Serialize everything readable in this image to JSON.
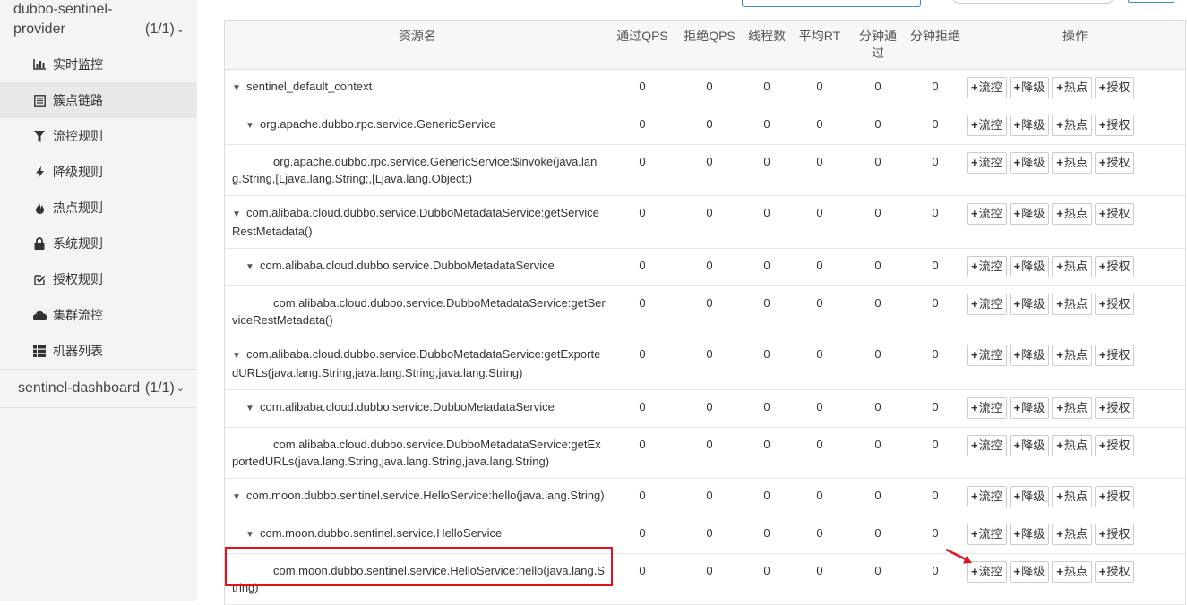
{
  "sidebar": {
    "app1": {
      "name_line1": "dubbo-sentinel-",
      "name_line2": "provider",
      "count": "(1/1)"
    },
    "menu": [
      {
        "label": "实时监控",
        "icon": "bar-chart-icon"
      },
      {
        "label": "簇点链路",
        "icon": "list-icon",
        "active": true
      },
      {
        "label": "流控规则",
        "icon": "filter-icon"
      },
      {
        "label": "降级规则",
        "icon": "bolt-icon"
      },
      {
        "label": "热点规则",
        "icon": "fire-icon"
      },
      {
        "label": "系统规则",
        "icon": "lock-icon"
      },
      {
        "label": "授权规则",
        "icon": "check-square-icon"
      },
      {
        "label": "集群流控",
        "icon": "cloud-icon"
      },
      {
        "label": "机器列表",
        "icon": "th-list-icon"
      }
    ],
    "app2": {
      "name": "sentinel-dashboard",
      "count": "(1/1)"
    }
  },
  "table": {
    "headers": {
      "resource": "资源名",
      "pass_qps": "通过QPS",
      "block_qps": "拒绝QPS",
      "threads": "线程数",
      "avg_rt": "平均RT",
      "minute_pass": "分钟通过",
      "minute_block": "分钟拒绝",
      "ops": "操作"
    },
    "buttons": {
      "flow": "流控",
      "degrade": "降级",
      "hot": "热点",
      "auth": "授权"
    },
    "rows": [
      {
        "name": "sentinel_default_context",
        "pass_qps": "0",
        "block_qps": "0",
        "threads": "0",
        "avg_rt": "0",
        "minute_pass": "0",
        "minute_block": "0"
      },
      {
        "name": "org.apache.dubbo.rpc.service.GenericService",
        "pass_qps": "0",
        "block_qps": "0",
        "threads": "0",
        "avg_rt": "0",
        "minute_pass": "0",
        "minute_block": "0"
      },
      {
        "name": "org.apache.dubbo.rpc.service.GenericService:$invoke(java.lang.String,[Ljava.lang.String;,[Ljava.lang.Object;)",
        "pass_qps": "0",
        "block_qps": "0",
        "threads": "0",
        "avg_rt": "0",
        "minute_pass": "0",
        "minute_block": "0"
      },
      {
        "name": "com.alibaba.cloud.dubbo.service.DubboMetadataService:getServiceRestMetadata()",
        "pass_qps": "0",
        "block_qps": "0",
        "threads": "0",
        "avg_rt": "0",
        "minute_pass": "0",
        "minute_block": "0"
      },
      {
        "name": "com.alibaba.cloud.dubbo.service.DubboMetadataService",
        "pass_qps": "0",
        "block_qps": "0",
        "threads": "0",
        "avg_rt": "0",
        "minute_pass": "0",
        "minute_block": "0"
      },
      {
        "name": "com.alibaba.cloud.dubbo.service.DubboMetadataService:getServiceRestMetadata()",
        "pass_qps": "0",
        "block_qps": "0",
        "threads": "0",
        "avg_rt": "0",
        "minute_pass": "0",
        "minute_block": "0"
      },
      {
        "name": "com.alibaba.cloud.dubbo.service.DubboMetadataService:getExportedURLs(java.lang.String,java.lang.String,java.lang.String)",
        "pass_qps": "0",
        "block_qps": "0",
        "threads": "0",
        "avg_rt": "0",
        "minute_pass": "0",
        "minute_block": "0"
      },
      {
        "name": "com.alibaba.cloud.dubbo.service.DubboMetadataService",
        "pass_qps": "0",
        "block_qps": "0",
        "threads": "0",
        "avg_rt": "0",
        "minute_pass": "0",
        "minute_block": "0"
      },
      {
        "name": "com.alibaba.cloud.dubbo.service.DubboMetadataService:getExportedURLs(java.lang.String,java.lang.String,java.lang.String)",
        "pass_qps": "0",
        "block_qps": "0",
        "threads": "0",
        "avg_rt": "0",
        "minute_pass": "0",
        "minute_block": "0"
      },
      {
        "name": "com.moon.dubbo.sentinel.service.HelloService:hello(java.lang.String)",
        "pass_qps": "0",
        "block_qps": "0",
        "threads": "0",
        "avg_rt": "0",
        "minute_pass": "0",
        "minute_block": "0"
      },
      {
        "name": "com.moon.dubbo.sentinel.service.HelloService",
        "pass_qps": "0",
        "block_qps": "0",
        "threads": "0",
        "avg_rt": "0",
        "minute_pass": "0",
        "minute_block": "0"
      },
      {
        "name": "com.moon.dubbo.sentinel.service.HelloService:hello(java.lang.String)",
        "pass_qps": "0",
        "block_qps": "0",
        "threads": "0",
        "avg_rt": "0",
        "minute_pass": "0",
        "minute_block": "0"
      }
    ]
  },
  "colors": {
    "highlight": "#e0121b",
    "accent": "#3c8dbc"
  }
}
